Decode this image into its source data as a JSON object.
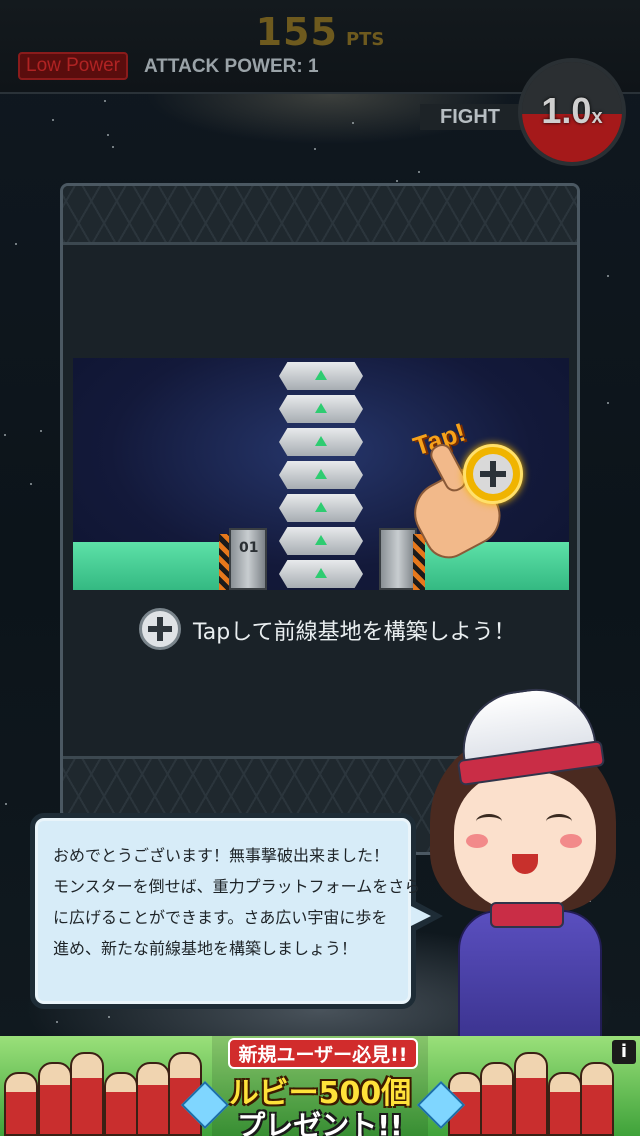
{
  "hud": {
    "score": "155",
    "score_unit": "PTS",
    "low_power_label": "Low Power",
    "attack_power_label": "ATTACK POWER: 1",
    "fight_label": "FIGHT",
    "multiplier": "1.0",
    "multiplier_suffix": "x"
  },
  "tutorial": {
    "tap_label": "Tap!",
    "pillar_label": "01",
    "caption": "Tapして前線基地を構築しよう！"
  },
  "dialog": {
    "lines": [
      "おめでとうございます！無事撃破出来ました！",
      "モンスターを倒せば、重力プラットフォームをさら",
      "に広げることができます。さあ広い宇宙に歩を",
      "進め、新たな前線基地を構築しましょう！"
    ]
  },
  "ad": {
    "line1": "新規ユーザー必見!!",
    "line2": "ルビー500個",
    "line3": "プレゼント!!",
    "info_label": "i"
  },
  "colors": {
    "score": "#6e5a1e",
    "multiplier_fill": "#a5191a",
    "dialog_bg": "#d7ecf8",
    "ground": "#4fd39c"
  }
}
